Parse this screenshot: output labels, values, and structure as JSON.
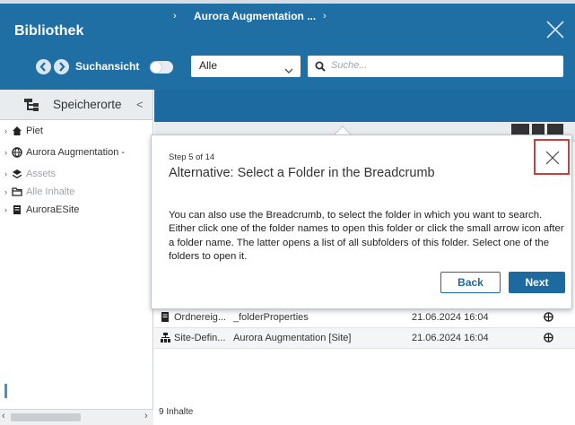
{
  "header": {
    "title": "Bibliothek",
    "search_view_label": "Suchansicht",
    "filter_select_value": "Alle",
    "search_placeholder": "Suche..."
  },
  "left_panel": {
    "title": "Speicherorte",
    "collapse_glyph": "<",
    "tree": [
      {
        "label": "Piet",
        "icon": "home-icon"
      },
      {
        "label": "Aurora Augmentation -",
        "icon": "site-globe-icon"
      },
      {
        "label": "Assets",
        "icon": "assets-icon",
        "muted": true
      },
      {
        "label": "Alle Inhalte",
        "icon": "folder-icon",
        "muted": true
      },
      {
        "label": "AuroraESite",
        "icon": "document-icon"
      }
    ]
  },
  "breadcrumb": {
    "folder_label": "Aurora Augmentation ...",
    "separator": "›"
  },
  "table": {
    "rows": [
      {
        "type": "Ordnereig...",
        "name": "_folderProperties",
        "date": "21.06.2024 16:04"
      },
      {
        "type": "Site-Defin...",
        "name": "Aurora Augmentation [Site]",
        "date": "21.06.2024 16:04"
      }
    ],
    "footer_count": "9 Inhalte"
  },
  "tour": {
    "step": "Step 5 of 14",
    "title": "Alternative: Select a Folder in the Breadcrumb",
    "body": "You can also use the Breadcrumb, to select the folder in which you want to search. Either click one of the folder names to open this folder or click the small arrow icon after a folder name. The latter opens a list of all subfolders of this folder. Select one of the folders to open it.",
    "back_label": "Back",
    "next_label": "Next"
  },
  "colors": {
    "header_blue": "#1f6ea4",
    "breadcrumb_blue": "#1c6aa0",
    "highlight_red": "#d23b3b"
  }
}
